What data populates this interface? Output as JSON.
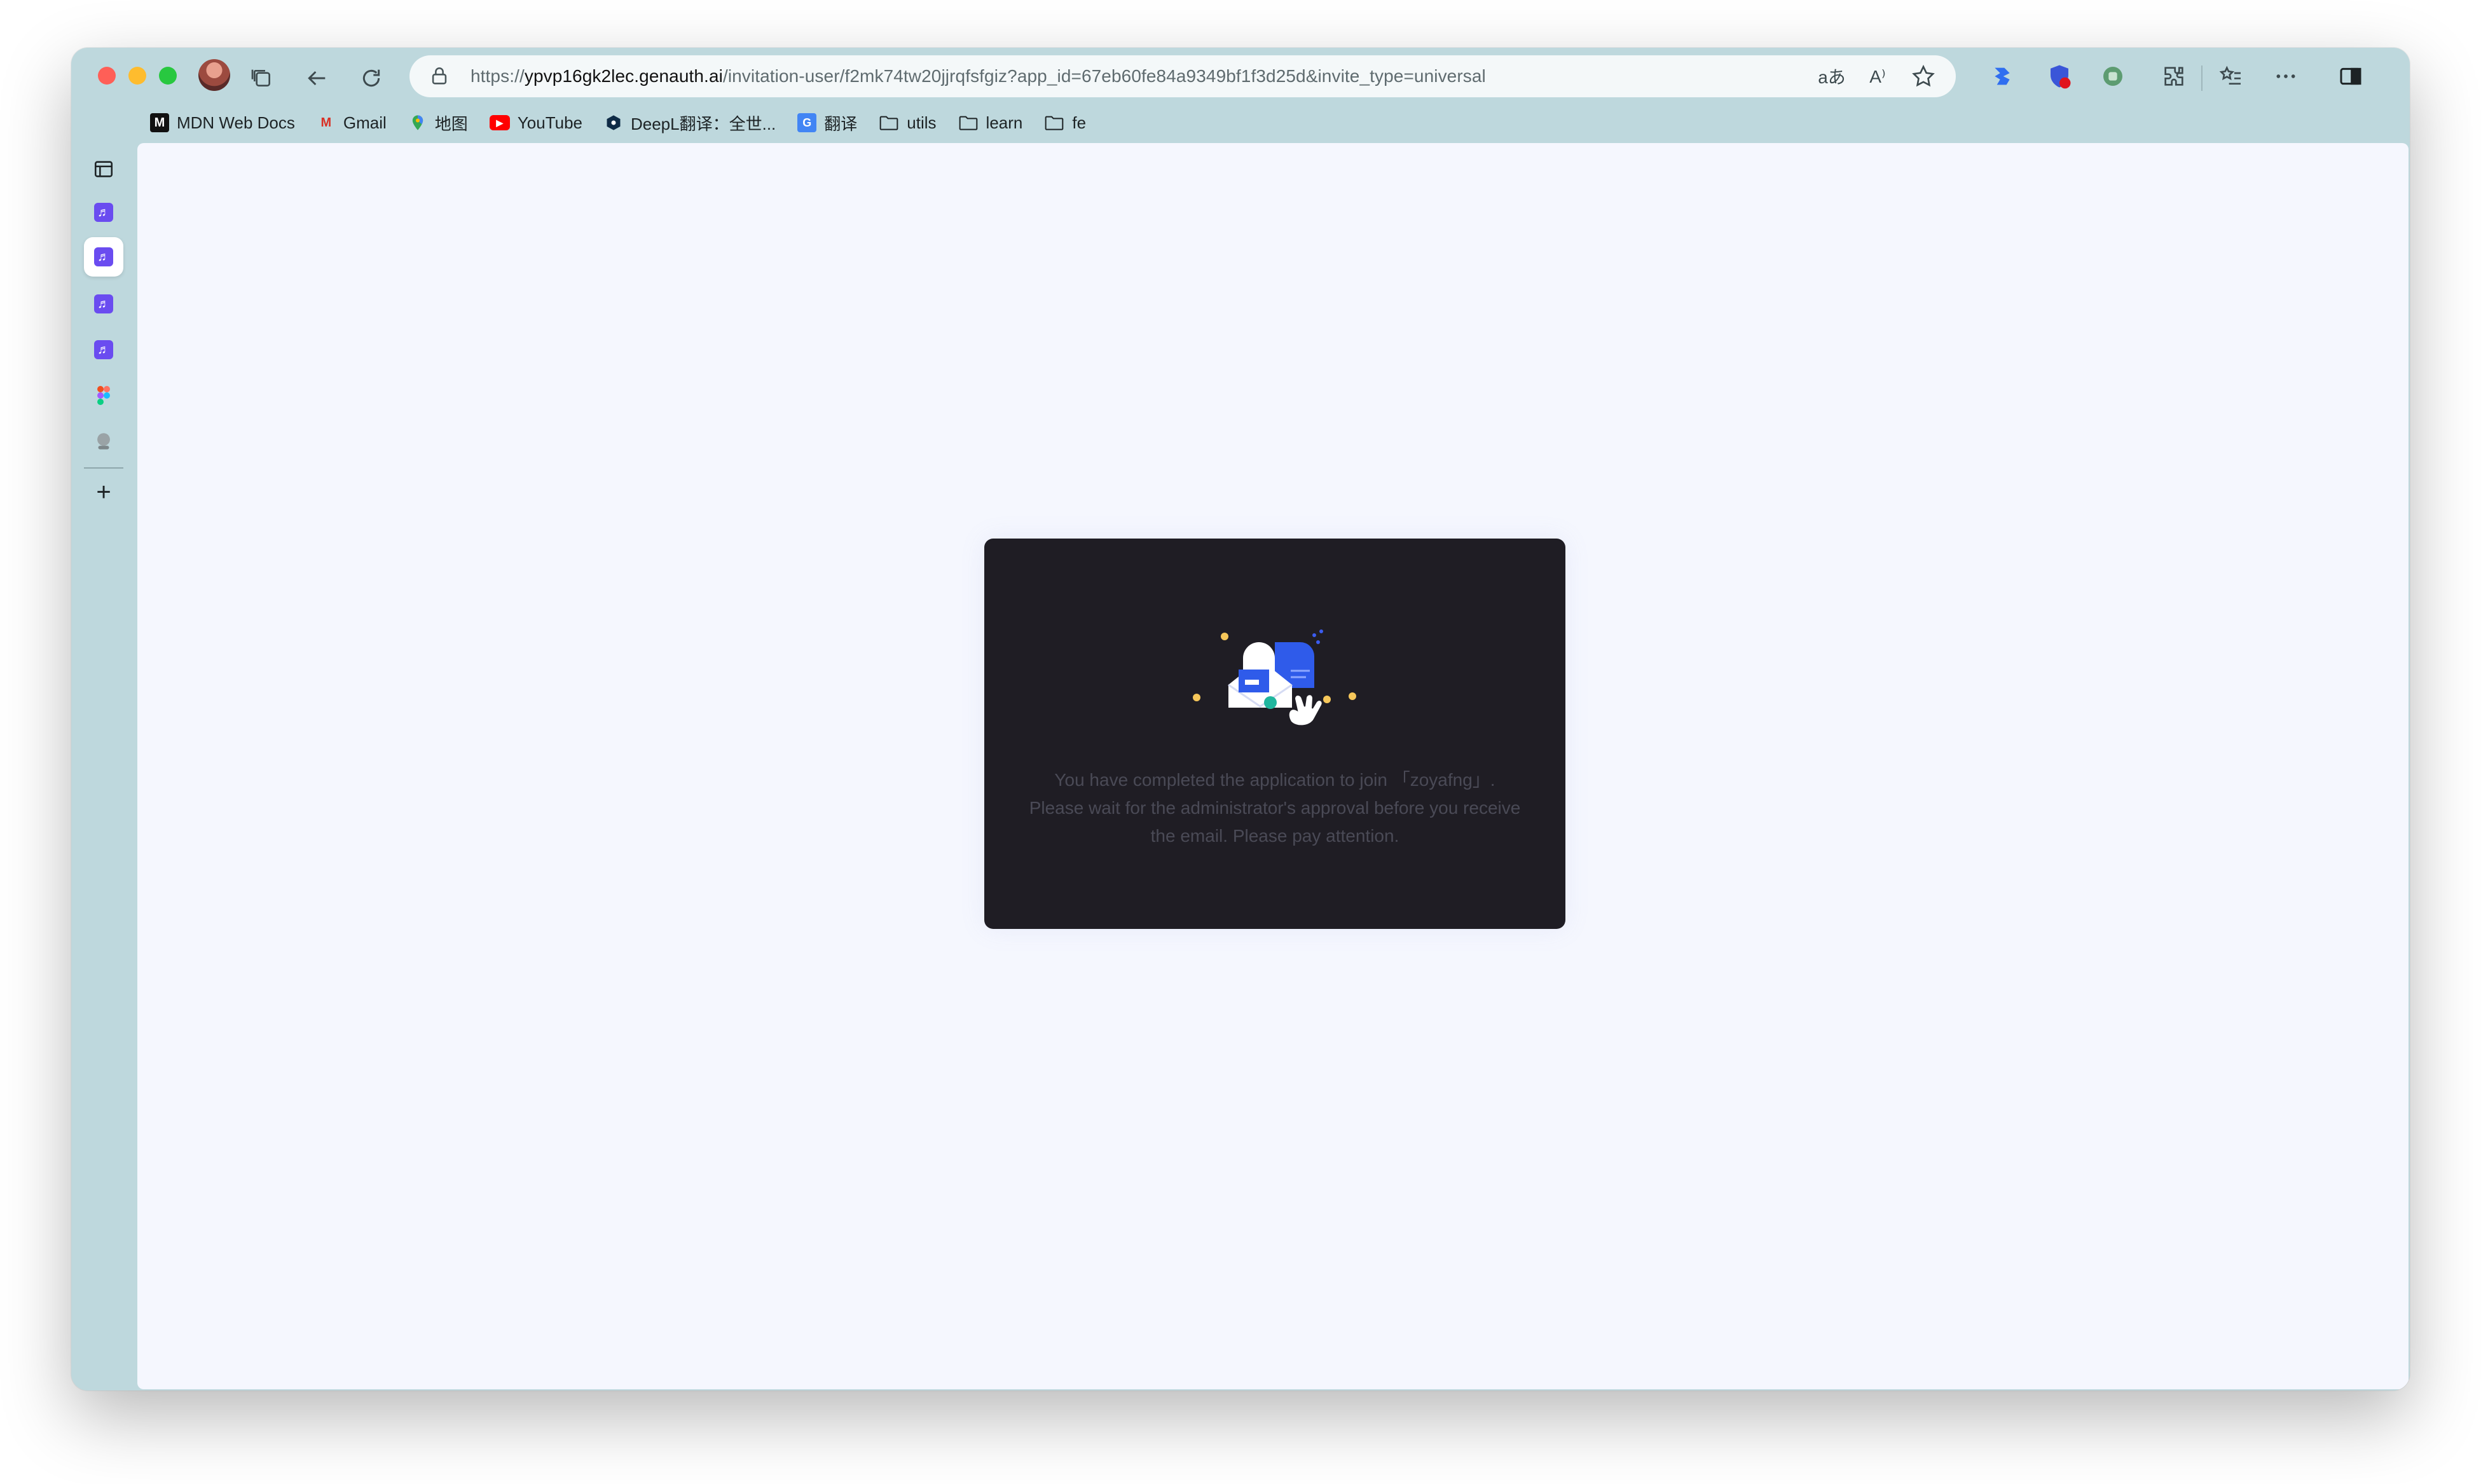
{
  "browser": {
    "url_scheme": "https://",
    "url_host": "ypvp16gk2lec.genauth.ai",
    "url_path": "/invitation-user/f2mk74tw20jjrqfsfgiz?app_id=67eb60fe84a9349bf1f3d25d&invite_type=universal",
    "translate_glyph": "aあ",
    "read_aloud_glyph": "A⁾"
  },
  "bookmarks": [
    {
      "label": "MDN Web Docs",
      "icon": "mdn-icon",
      "glyph": "M"
    },
    {
      "label": "Gmail",
      "icon": "gmail-icon",
      "glyph": "M"
    },
    {
      "label": "地图",
      "icon": "maps-pin-icon",
      "glyph": ""
    },
    {
      "label": "YouTube",
      "icon": "youtube-icon",
      "glyph": "▶"
    },
    {
      "label": "DeepL翻译：全世...",
      "icon": "deepl-icon",
      "glyph": ""
    },
    {
      "label": "翻译",
      "icon": "google-translate-icon",
      "glyph": "G"
    },
    {
      "label": "utils",
      "icon": "folder-icon"
    },
    {
      "label": "learn",
      "icon": "folder-icon"
    },
    {
      "label": "fe",
      "icon": "folder-icon"
    }
  ],
  "sidebar": {
    "app_glyph": "♬",
    "add_glyph": "+"
  },
  "card": {
    "message_line1": "You have completed the application to join 「zoyafng」.",
    "message_line2": "Please wait for the administrator's approval before you receive",
    "message_line3": "the email. Please pay attention."
  },
  "colors": {
    "window_frame": "#bed8dd",
    "page_bg": "#f5f7fe",
    "card_bg": "#1f1d24",
    "card_text": "#4a4a56",
    "accent_blue": "#2f5bea",
    "app_purple": "#6a4cf0"
  }
}
